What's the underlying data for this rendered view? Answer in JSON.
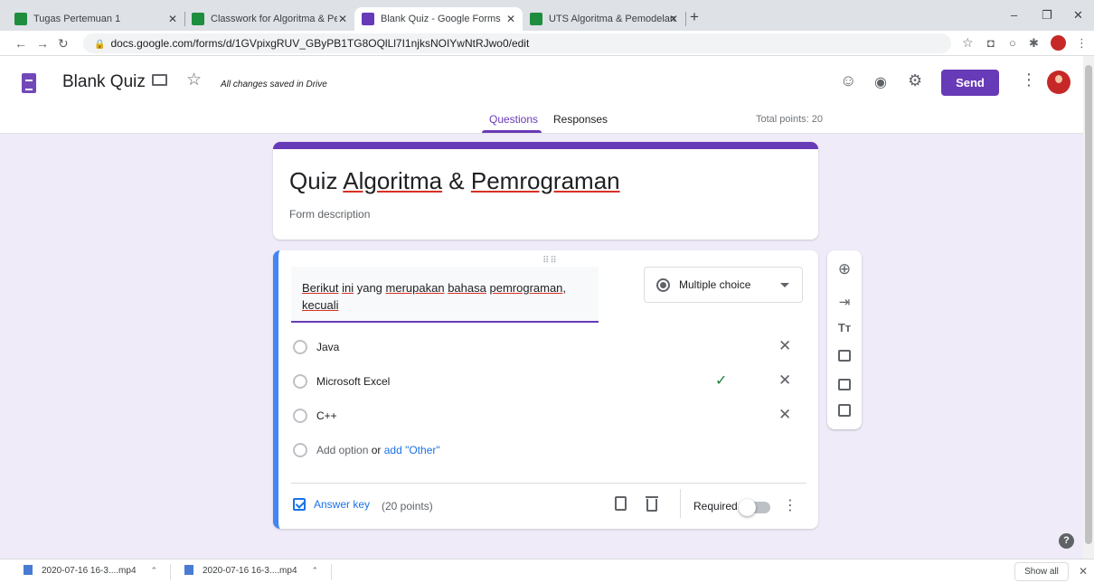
{
  "browser": {
    "tabs": [
      {
        "title": "Tugas Pertemuan 1",
        "close": "✕",
        "color": "#1e8e3e"
      },
      {
        "title": "Classwork for Algoritma & Pemro",
        "close": "✕",
        "color": "#1e8e3e"
      },
      {
        "title": "Blank Quiz - Google Forms",
        "close": "✕",
        "color": "#673ab7"
      },
      {
        "title": "UTS Algoritma & Pemodelan",
        "close": "✕",
        "color": "#1e8e3e"
      }
    ],
    "new_tab": "+",
    "url": "docs.google.com/forms/d/1GVpixgRUV_GByPB1TG8OQlLl7I1njksNOIYwNtRJwo0/edit"
  },
  "forms_header": {
    "doc_title": "Blank Quiz",
    "saved_status": "All changes saved in Drive",
    "send_label": "Send",
    "tabs": {
      "questions": "Questions",
      "responses": "Responses"
    },
    "total_points": "Total points: 20",
    "accent": "#673ab7"
  },
  "form": {
    "title_prefix": "Quiz ",
    "title_word1": "Algoritma",
    "title_mid": " & ",
    "title_word2": "Pemrograman",
    "description_placeholder": "Form description"
  },
  "question": {
    "text_parts": [
      "Berikut",
      " ",
      "ini",
      " yang ",
      "merupakan",
      " ",
      "bahasa",
      " ",
      "pemrograman",
      ", ",
      "kecuali"
    ],
    "type_label": "Multiple choice",
    "options": [
      {
        "label": "Java",
        "correct": false
      },
      {
        "label": "Microsoft Excel",
        "correct": true
      },
      {
        "label": "C++",
        "correct": false
      }
    ],
    "add_option": "Add option",
    "or": " or ",
    "add_other": "add \"Other\"",
    "answer_key": "Answer key",
    "points": "(20 points)",
    "required_label": "Required",
    "required": false
  },
  "downloads": {
    "items": [
      {
        "name": "2020-07-16 16-3....mp4"
      },
      {
        "name": "2020-07-16 16-3....mp4"
      }
    ],
    "show_all": "Show all"
  }
}
